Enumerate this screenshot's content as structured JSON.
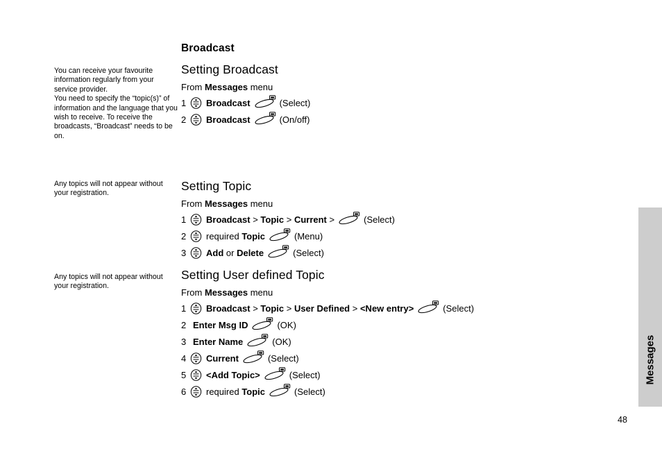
{
  "chapter": {
    "title": "Broadcast"
  },
  "thumb_tab": {
    "label": "Messages",
    "color": "#cdcdcd"
  },
  "page_number": "48",
  "icons": {
    "nav_key": "navigation-key-icon",
    "soft_key": "soft-key-icon"
  },
  "sections": [
    {
      "margin_note": "You can receive your favourite information regularly from your service provider.\nYou need to specify the “topic(s)” of information and the language that you wish to receive. To receive the broadcasts, “Broadcast” needs to be on.",
      "title": "Setting Broadcast",
      "from_prefix": "From ",
      "from_menu": "Messages",
      "from_suffix": " menu",
      "steps": [
        {
          "num": "1",
          "nav": true,
          "text_parts": [
            {
              "t": "Broadcast",
              "b": true
            }
          ],
          "soft": true,
          "action": "(Select)"
        },
        {
          "num": "2",
          "nav": true,
          "text_parts": [
            {
              "t": "Broadcast",
              "b": true
            }
          ],
          "soft": true,
          "action": "(On/off)"
        }
      ]
    },
    {
      "margin_note": "Any topics will not appear without your registration.",
      "title": "Setting Topic",
      "from_prefix": "From ",
      "from_menu": "Messages",
      "from_suffix": " menu",
      "steps": [
        {
          "num": "1",
          "nav": true,
          "text_parts": [
            {
              "t": "Broadcast",
              "b": true
            },
            {
              "t": " > ",
              "b": false
            },
            {
              "t": "Topic",
              "b": true
            },
            {
              "t": " > ",
              "b": false
            },
            {
              "t": "Current",
              "b": true
            },
            {
              "t": " >",
              "b": false
            }
          ],
          "soft": true,
          "action": "(Select)"
        },
        {
          "num": "2",
          "nav": true,
          "text_parts": [
            {
              "t": "required ",
              "b": false
            },
            {
              "t": "Topic",
              "b": true
            }
          ],
          "soft": true,
          "action": "(Menu)"
        },
        {
          "num": "3",
          "nav": true,
          "text_parts": [
            {
              "t": "Add",
              "b": true
            },
            {
              "t": " or ",
              "b": false
            },
            {
              "t": "Delete",
              "b": true
            }
          ],
          "soft": true,
          "action": "(Select)"
        }
      ]
    },
    {
      "margin_note": "Any topics will not appear without your registration.",
      "title": "Setting User defined Topic",
      "from_prefix": "From ",
      "from_menu": "Messages",
      "from_suffix": " menu",
      "steps": [
        {
          "num": "1",
          "nav": true,
          "text_parts": [
            {
              "t": "Broadcast",
              "b": true
            },
            {
              "t": " > ",
              "b": false
            },
            {
              "t": "Topic",
              "b": true
            },
            {
              "t": " > ",
              "b": false
            },
            {
              "t": "User Defined",
              "b": true
            },
            {
              "t": " > ",
              "b": false
            },
            {
              "t": "<New entry>",
              "b": true
            }
          ],
          "soft": true,
          "action": "(Select)"
        },
        {
          "num": "2",
          "nav": false,
          "text_parts": [
            {
              "t": "Enter Msg ID",
              "b": true
            }
          ],
          "soft": true,
          "action": "(OK)"
        },
        {
          "num": "3",
          "nav": false,
          "text_parts": [
            {
              "t": "Enter Name",
              "b": true
            }
          ],
          "soft": true,
          "action": "(OK)"
        },
        {
          "num": "4",
          "nav": true,
          "text_parts": [
            {
              "t": "Current",
              "b": true
            }
          ],
          "soft": true,
          "action": "(Select)"
        },
        {
          "num": "5",
          "nav": true,
          "text_parts": [
            {
              "t": "<Add Topic>",
              "b": true
            }
          ],
          "soft": true,
          "action": "(Select)"
        },
        {
          "num": "6",
          "nav": true,
          "text_parts": [
            {
              "t": "required ",
              "b": false
            },
            {
              "t": "Topic",
              "b": true
            }
          ],
          "soft": true,
          "action": "(Select)"
        }
      ]
    }
  ]
}
